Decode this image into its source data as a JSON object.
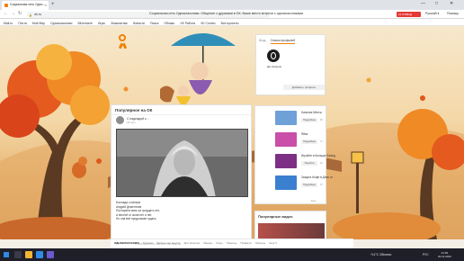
{
  "browser": {
    "tab_title": "Социальная сеть Одно...",
    "new_tab": "+",
    "window_controls": {
      "minimize": "—",
      "maximize": "□",
      "close": "✕"
    },
    "url": "ok.ru",
    "page_title": "Социальная сеть Одноклассники. Общение с друзьями в ОК. Ваше место встречи с одноклассниками",
    "badge": "21 ПОВОД",
    "lang": "Русский ▾",
    "help": "Помощь",
    "bookmarks": [
      "Mail.ru",
      "Почта",
      "Моё Мир",
      "Одноклассники",
      "ВКонтакте",
      "Игры",
      "Знакомства",
      "Новости",
      "Поиск",
      "Облако",
      "VK Работа",
      "VK Combo",
      "Все проекты"
    ]
  },
  "feed": {
    "header": "Популярное на ОК",
    "author": "С надеждой к ...",
    "time": "29 июл",
    "post_lines": [
      "Баллада о матери",
      "Андрей Дементьев",
      "Постарела мать за тридцать лет,",
      "А вестей от сына нет и нет.",
      "Но она всё продолжает ждать."
    ]
  },
  "login_panel": {
    "tabs": [
      "Вход",
      "Список профилей"
    ],
    "profile_name": "Дм Казаков",
    "add_profile": "Добавить профиль"
  },
  "apps": [
    {
      "name": "Копилка Мечты",
      "sub": "",
      "button": "Подробнее",
      "count": "68",
      "color": "#6fa0d8"
    },
    {
      "name": "Яйка",
      "sub": "",
      "button": "Подробнее",
      "count": "72",
      "color": "#c94fa8"
    },
    {
      "name": "Играйте в Кольцах Бильд",
      "sub": "",
      "button": "Перейти",
      "count": "46",
      "color": "#7d2f86"
    },
    {
      "name": "Защита Кофе в Днях от",
      "sub": "",
      "button": "Подробнее",
      "count": "37",
      "color": "#3b7fd1"
    }
  ],
  "apps_more": "Ещё",
  "video": {
    "header": "Популярные видео"
  },
  "footer": {
    "brand": "ОДНОКЛАССНИКИ",
    "links": [
      "Русский",
      "Мобильная версия",
      "Для бизнеса",
      "Звезды",
      "Игры",
      "Помощь",
      "Правила",
      "Помощь",
      "Ещё ▾"
    ],
    "copyright": "© 2006-2023 ООО «ВК/ОК» / 12+ Best Ru"
  },
  "taskbar": {
    "weather": "+11°C Облачно",
    "lang": "РУС",
    "time": "21:36",
    "date": "20.11.2023"
  }
}
